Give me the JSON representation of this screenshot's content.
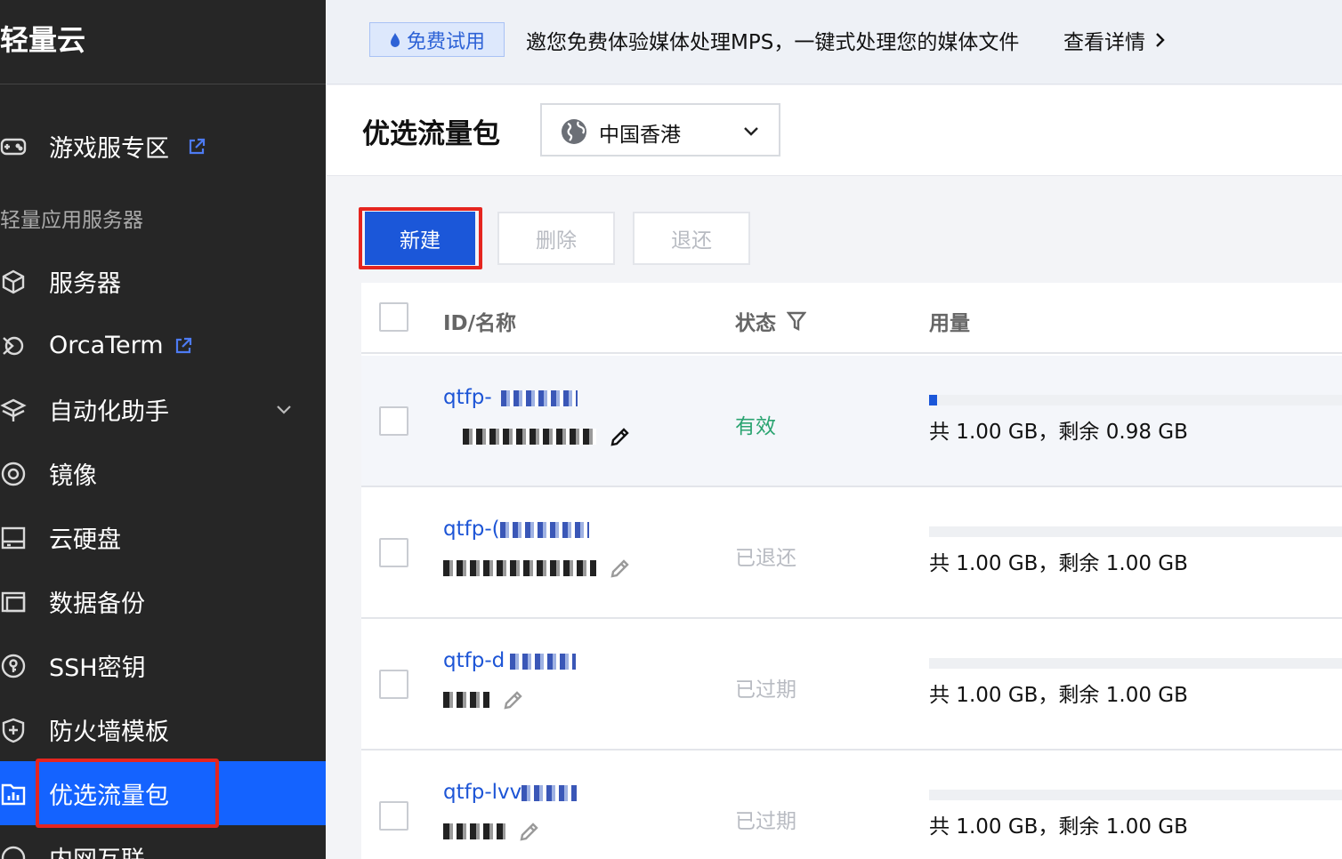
{
  "sidebar": {
    "brand": "轻量云",
    "group_title": "轻量应用服务器",
    "items": [
      {
        "label": "游戏服专区",
        "icon": "gamepad-icon",
        "external": true
      },
      {
        "label": "服务器",
        "icon": "cube-icon"
      },
      {
        "label": "OrcaTerm",
        "icon": "terminal-icon",
        "external": true
      },
      {
        "label": "自动化助手",
        "icon": "automation-icon",
        "expandable": true
      },
      {
        "label": "镜像",
        "icon": "disc-icon"
      },
      {
        "label": "云硬盘",
        "icon": "disk-icon"
      },
      {
        "label": "数据备份",
        "icon": "backup-icon"
      },
      {
        "label": "SSH密钥",
        "icon": "key-icon"
      },
      {
        "label": "防火墙模板",
        "icon": "shield-icon"
      },
      {
        "label": "优选流量包",
        "icon": "traffic-package-icon",
        "active": true
      },
      {
        "label": "内网互联",
        "icon": "network-icon"
      }
    ]
  },
  "banner": {
    "tag": "免费试用",
    "text": "邀您免费体验媒体处理MPS，一键式处理您的媒体文件",
    "link": "查看详情"
  },
  "header": {
    "title": "优选流量包",
    "region": "中国香港"
  },
  "toolbar": {
    "new_label": "新建",
    "delete_label": "删除",
    "return_label": "退还"
  },
  "table": {
    "columns": {
      "id_name": "ID/名称",
      "status": "状态",
      "usage": "用量"
    },
    "rows": [
      {
        "id": "qtfp-",
        "status": "有效",
        "status_color": "#2ba471",
        "usage": "共 1.00 GB，剩余 0.98 GB",
        "used_fraction": 0.02
      },
      {
        "id": "qtfp-(",
        "status": "已退还",
        "status_color": "#b8bbc2",
        "usage": "共 1.00 GB，剩余 1.00 GB",
        "used_fraction": 0
      },
      {
        "id": "qtfp-d",
        "status": "已过期",
        "status_color": "#b8bbc2",
        "usage": "共 1.00 GB，剩余 1.00 GB",
        "used_fraction": 0
      },
      {
        "id": "qtfp-lvv",
        "status": "已过期",
        "status_color": "#b8bbc2",
        "usage": "共 1.00 GB，剩余 1.00 GB",
        "used_fraction": 0
      }
    ]
  },
  "colors": {
    "accent": "#1b57d9",
    "sidebar_bg": "#262626",
    "active_nav": "#1463ff",
    "highlight": "#e5251f",
    "valid": "#2ba471"
  }
}
